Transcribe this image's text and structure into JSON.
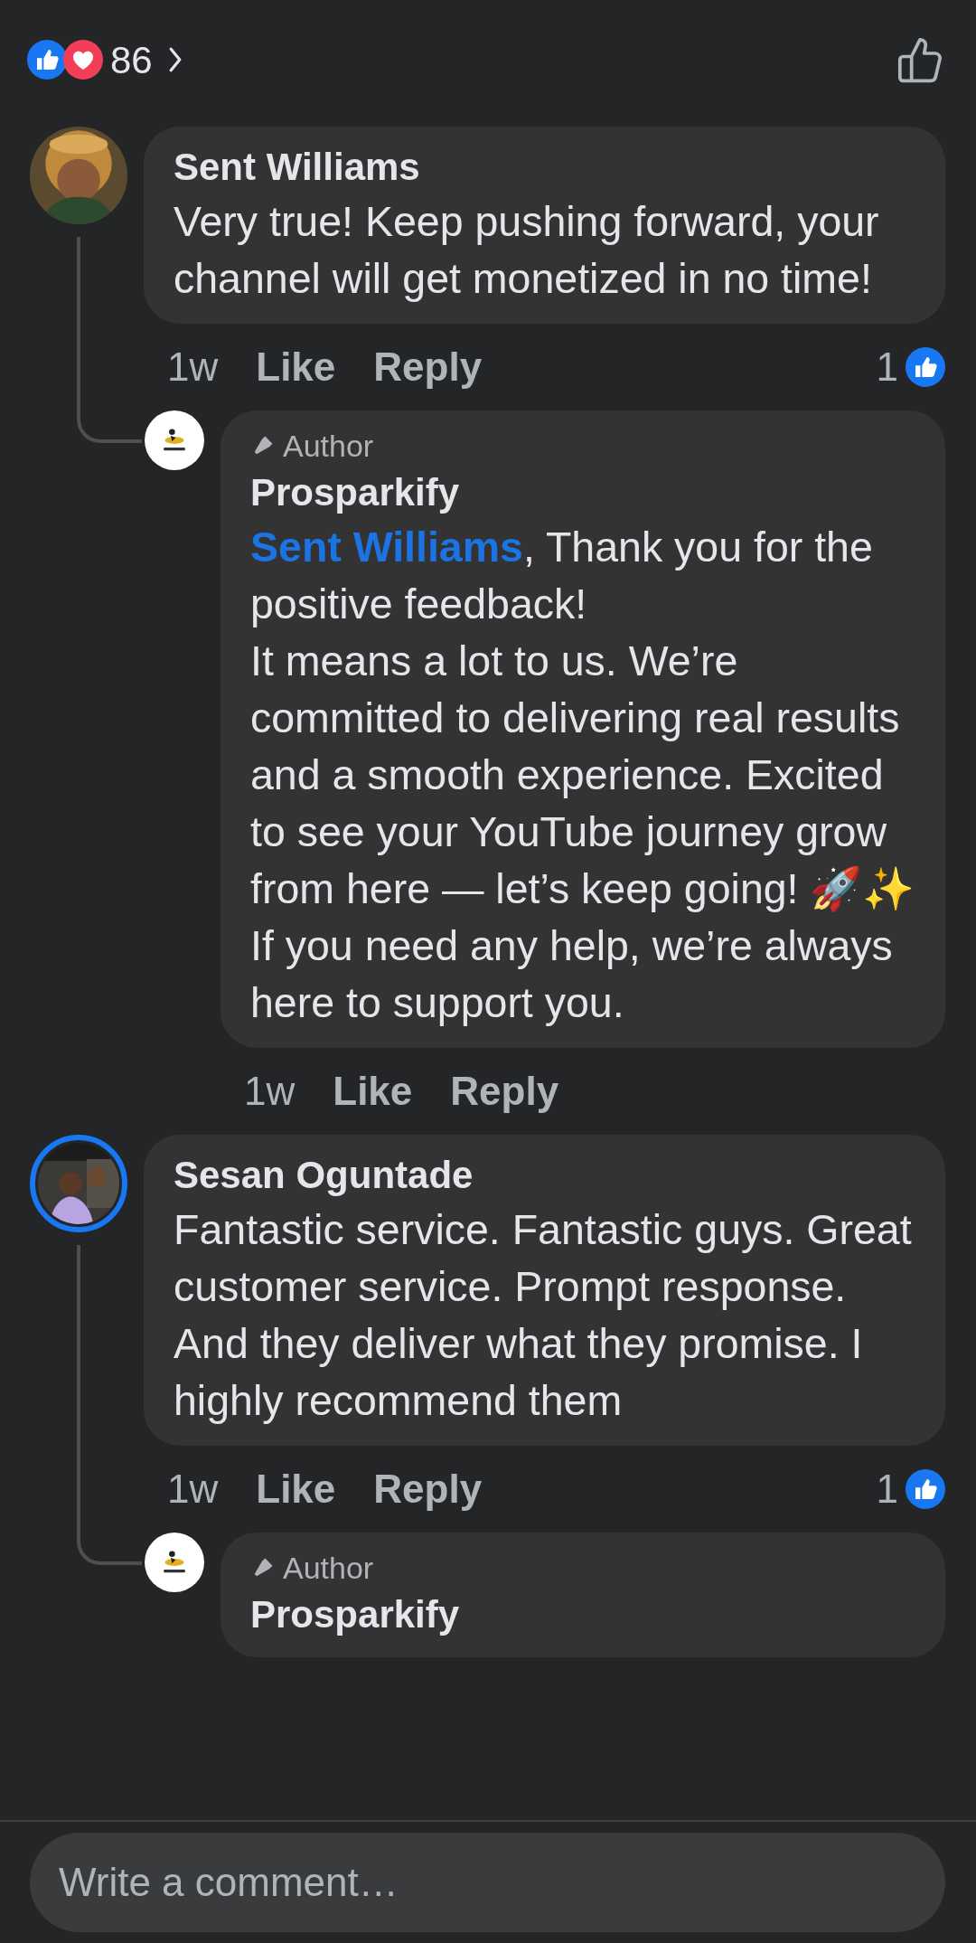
{
  "reactions_bar": {
    "count": "86"
  },
  "comments": [
    {
      "author": "Sent Williams",
      "story_ring": false,
      "avatar": {
        "kind": "picture"
      },
      "text": "Very true! Keep pushing forward, your channel will get monetized in no time!",
      "time": "1w",
      "actions": [
        "Like",
        "Reply"
      ],
      "like_count": "1",
      "replies": [
        {
          "badge": "Author",
          "author": "Prosparkify",
          "avatar": {
            "kind": "picture"
          },
          "mention": "Sent Williams",
          "text": ", Thank you for the positive feedback!\nIt means a lot to us. We’re committed to delivering real results and a smooth experience. Excited to see your YouTube journey grow from here — let’s keep going! 🚀✨\nIf you need any help, we’re always here to support you.",
          "time": "1w",
          "actions": [
            "Like",
            "Reply"
          ]
        }
      ]
    },
    {
      "author": "Sesan Oguntade",
      "story_ring": true,
      "avatar": {
        "kind": "picture"
      },
      "text": "Fantastic service. Fantastic guys. Great customer service. Prompt response. And they deliver what they promise. I highly recommend them",
      "time": "1w",
      "actions": [
        "Like",
        "Reply"
      ],
      "like_count": "1",
      "replies": [
        {
          "badge": "Author",
          "author": "Prosparkify",
          "avatar": {
            "kind": "picture"
          }
        }
      ]
    }
  ],
  "composer": {
    "placeholder": "Write a comment…"
  }
}
